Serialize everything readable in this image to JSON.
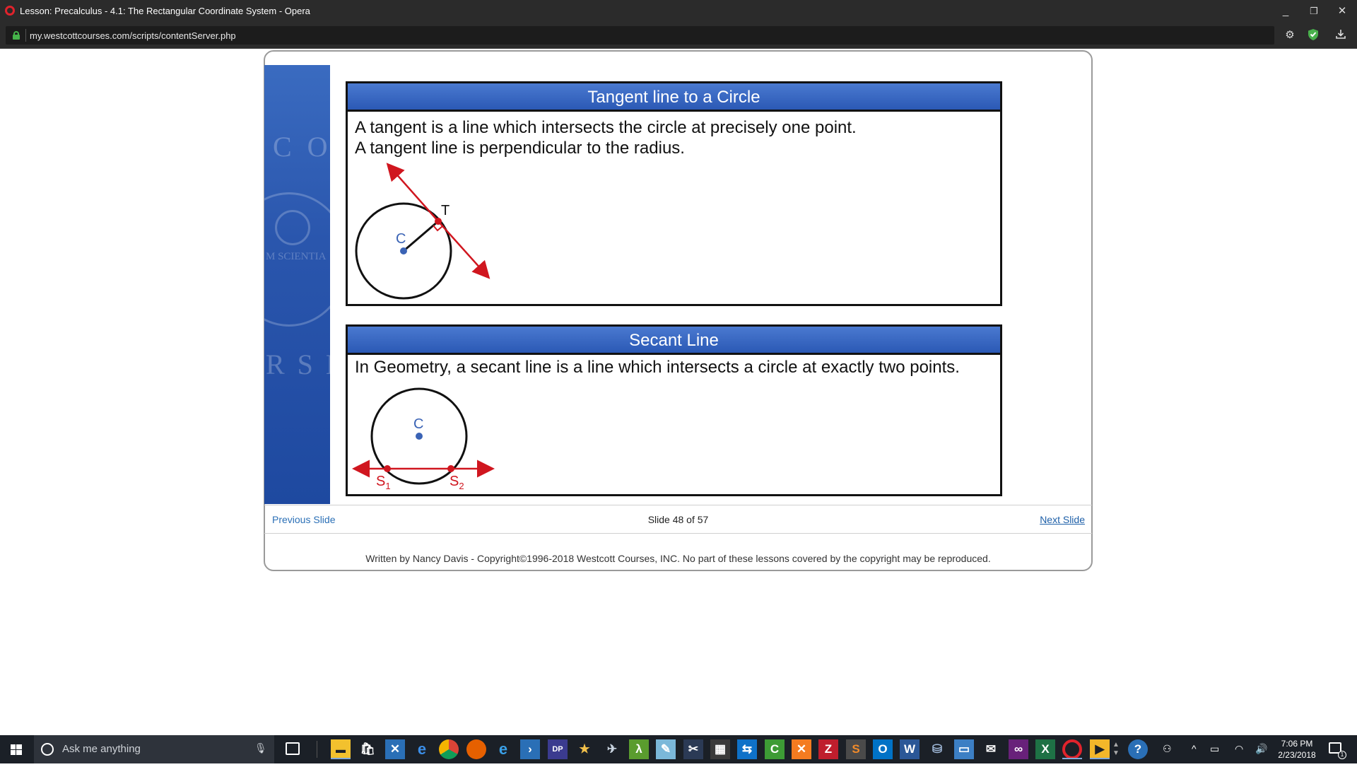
{
  "window": {
    "title": "Lesson: Precalculus - 4.1: The Rectangular Coordinate System - Opera",
    "minimize": "_",
    "restore": "❐",
    "close": "✕"
  },
  "address": {
    "url": "my.westcottcourses.com/scripts/contentServer.php"
  },
  "sidebar": {
    "watermark_top": "C O",
    "watermark_mid": "M SCIENTIA",
    "watermark_bottom": "R S E"
  },
  "tangent_panel": {
    "title": "Tangent line to a Circle",
    "line1": "A tangent is a line which intersects the circle at precisely one point.",
    "line2": "A tangent line is perpendicular to the radius.",
    "label_center": "C",
    "label_point": "T"
  },
  "secant_panel": {
    "title": "Secant Line",
    "line1": "In Geometry, a secant line is a line which intersects a circle at exactly two points.",
    "label_center": "C",
    "label_s1": "S",
    "label_s1_sub": "1",
    "label_s2": "S",
    "label_s2_sub": "2"
  },
  "nav": {
    "previous": "Previous Slide",
    "slide_count": "Slide 48 of 57",
    "next": "Next Slide"
  },
  "footer": {
    "text": "Written by Nancy Davis - Copyright©1996-2018 Westcott Courses, INC. No part of these lessons covered by the copyright may be reproduced."
  },
  "taskbar": {
    "search_placeholder": "Ask me anything",
    "clock_time": "7:06 PM",
    "clock_date": "2/23/2018",
    "notification_count": "1"
  },
  "colors": {
    "panel_header": "#3366c2",
    "diagram_red": "#d0161f",
    "diagram_blue": "#3a63b5"
  }
}
